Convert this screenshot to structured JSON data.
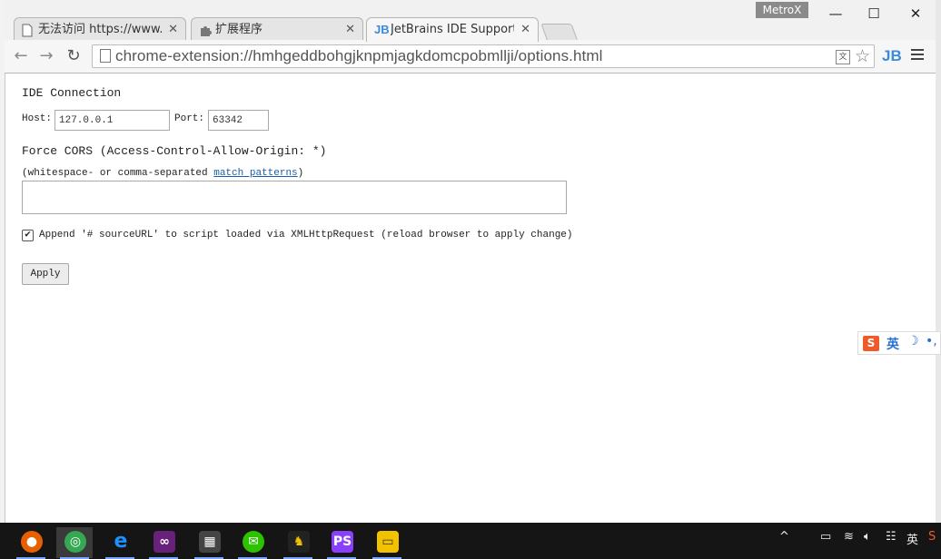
{
  "browser": {
    "profile_name": "MetroX",
    "tabs": [
      {
        "title": "无法访问 https://www.go",
        "icon": "page-icon",
        "active": false
      },
      {
        "title": "扩展程序",
        "icon": "puzzle-icon",
        "active": false
      },
      {
        "title": "JetBrains IDE Support O",
        "icon": "jetbrains-icon",
        "active": true
      }
    ],
    "address": "chrome-extension://hmhgeddbohgjknpmjagkdomcpobmllji/options.html",
    "window_controls": {
      "minimize": "—",
      "maximize": "☐",
      "close": "✕"
    }
  },
  "page": {
    "section_ide": "IDE Connection",
    "host_label": "Host:",
    "host_value": "127.0.0.1",
    "port_label": "Port:",
    "port_value": "63342",
    "section_cors": "Force CORS (Access-Control-Allow-Origin: *)",
    "cors_hint_prefix": "(whitespace- or comma-separated ",
    "cors_hint_link": "match patterns",
    "cors_hint_suffix": ")",
    "cors_value": "",
    "append_checked": true,
    "append_label": "Append '# sourceURL' to script loaded via XMLHttpRequest (reload browser to apply change)",
    "apply_label": "Apply"
  },
  "ime": {
    "logo": "S",
    "mode": "英",
    "moon": "☽",
    "punct": "•,"
  },
  "taskbar": {
    "apps": [
      {
        "name": "firefox",
        "color": "#e66000"
      },
      {
        "name": "chrome",
        "color": "#34a853"
      },
      {
        "name": "internet-explorer",
        "color": "#1e90ff"
      },
      {
        "name": "visual-studio",
        "color": "#68217a"
      },
      {
        "name": "app",
        "color": "#444444"
      },
      {
        "name": "wechat",
        "color": "#2dc100"
      },
      {
        "name": "qq",
        "color": "#222222"
      },
      {
        "name": "phpstorm",
        "color": "#8a3ffc"
      },
      {
        "name": "file-explorer",
        "color": "#f2c200"
      }
    ],
    "tray": {
      "up_arrow": "^",
      "input_lang": "英"
    }
  },
  "colors": {
    "link": "#1a5ea9",
    "accent": "#3c8ad8"
  }
}
